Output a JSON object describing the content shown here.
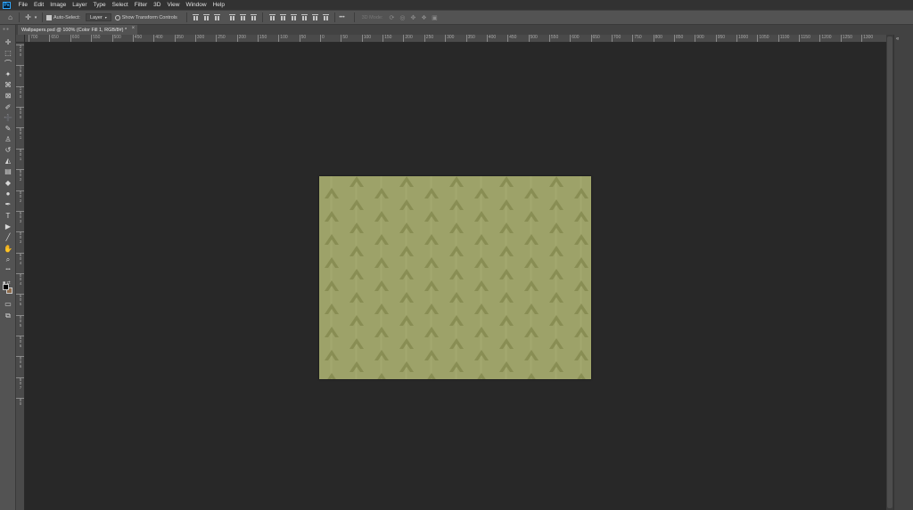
{
  "app": {
    "logo_text": "Ps",
    "menu": [
      "File",
      "Edit",
      "Image",
      "Layer",
      "Type",
      "Select",
      "Filter",
      "3D",
      "View",
      "Window",
      "Help"
    ]
  },
  "options_bar": {
    "home_icon": "home-icon",
    "move_icon": "move-icon",
    "auto_select_label": "Auto-Select:",
    "auto_select_checked": true,
    "layer_select_value": "Layer",
    "transform_label": "Show Transform Controls",
    "transform_checked": false,
    "more_label": "•••",
    "mode_3d_label": "3D Mode:"
  },
  "document_tab": {
    "title": "Wallpapers.psd @ 100% (Color Fill 1, RGB/8#) *",
    "close_glyph": "×"
  },
  "ruler_h_labels": [
    "700",
    "650",
    "600",
    "550",
    "500",
    "450",
    "400",
    "350",
    "300",
    "250",
    "200",
    "150",
    "100",
    "50",
    "0",
    "50",
    "100",
    "150",
    "200",
    "250",
    "300",
    "350",
    "400",
    "450",
    "500",
    "550",
    "600",
    "650",
    "700",
    "750",
    "800",
    "850",
    "900",
    "950",
    "1000",
    "1050",
    "1100",
    "1150",
    "1200",
    "1250",
    "1300"
  ],
  "ruler_v_labels": [
    "2",
    "0",
    "0",
    "1",
    "5",
    "0",
    "1",
    "0",
    "0",
    "5",
    "0",
    "0",
    "5",
    "0",
    "1",
    "0",
    "0",
    "1",
    "5",
    "0",
    "2",
    "0",
    "0",
    "2",
    "5",
    "0",
    "3",
    "0",
    "0",
    "3",
    "5",
    "0",
    "4",
    "0",
    "0",
    "4",
    "5",
    "0",
    "5",
    "0",
    "0",
    "5",
    "5",
    "0",
    "6",
    "0",
    "0",
    "6",
    "5",
    "0",
    "7",
    "0",
    "0"
  ],
  "tools": [
    {
      "name": "move-tool",
      "glyph": "✛"
    },
    {
      "name": "marquee-tool",
      "glyph": "⬚"
    },
    {
      "name": "lasso-tool",
      "glyph": "⌒"
    },
    {
      "name": "magic-wand-tool",
      "glyph": "✦"
    },
    {
      "name": "crop-tool",
      "glyph": "⌘"
    },
    {
      "name": "frame-tool",
      "glyph": "⊠"
    },
    {
      "name": "eyedropper-tool",
      "glyph": "✐"
    },
    {
      "name": "healing-brush-tool",
      "glyph": "➕"
    },
    {
      "name": "brush-tool",
      "glyph": "✎"
    },
    {
      "name": "clone-stamp-tool",
      "glyph": "♙"
    },
    {
      "name": "history-brush-tool",
      "glyph": "↺"
    },
    {
      "name": "eraser-tool",
      "glyph": "◭"
    },
    {
      "name": "gradient-tool",
      "glyph": "▤"
    },
    {
      "name": "blur-tool",
      "glyph": "◆"
    },
    {
      "name": "dodge-tool",
      "glyph": "●"
    },
    {
      "name": "pen-tool",
      "glyph": "✒"
    },
    {
      "name": "type-tool",
      "glyph": "T"
    },
    {
      "name": "path-selection-tool",
      "glyph": "▶"
    },
    {
      "name": "line-tool",
      "glyph": "╱"
    },
    {
      "name": "hand-tool",
      "glyph": "✋"
    },
    {
      "name": "zoom-tool",
      "glyph": "⌕"
    },
    {
      "name": "edit-toolbar",
      "glyph": "•••"
    },
    {
      "name": "quick-mask-tool",
      "glyph": "▭"
    },
    {
      "name": "screen-mode-tool",
      "glyph": "⧉"
    }
  ],
  "colors": {
    "foreground": "#000000",
    "background": "#8c6a4a",
    "document_fill": "#9da269",
    "pattern_dark": "#858a50",
    "pattern_stripe": "#a7ac73"
  }
}
